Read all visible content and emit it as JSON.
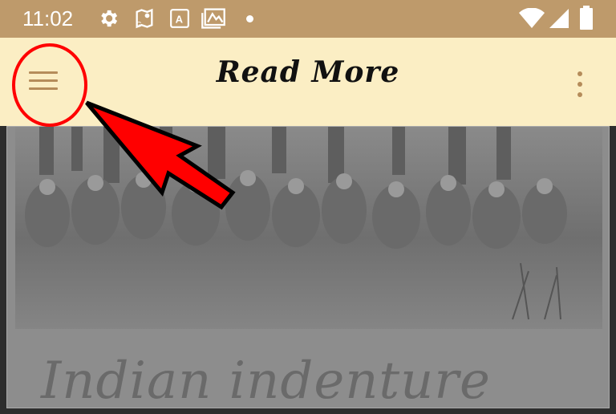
{
  "status_bar": {
    "time": "11:02",
    "icons": [
      "settings-icon",
      "maps-icon",
      "text-icon",
      "photo-icon",
      "dot-icon",
      "wifi-icon",
      "signal-icon",
      "battery-icon"
    ]
  },
  "app_bar": {
    "title": "Read More",
    "menu_icon": "hamburger-icon",
    "overflow_icon": "more-vert-icon"
  },
  "article": {
    "image_alt": "historical group photograph",
    "headline": "Indian indenture"
  },
  "colors": {
    "status_bar": "#be9a6b",
    "app_bar": "#fbeec4",
    "accent": "#b58c5a",
    "annotation": "#ff0000"
  }
}
